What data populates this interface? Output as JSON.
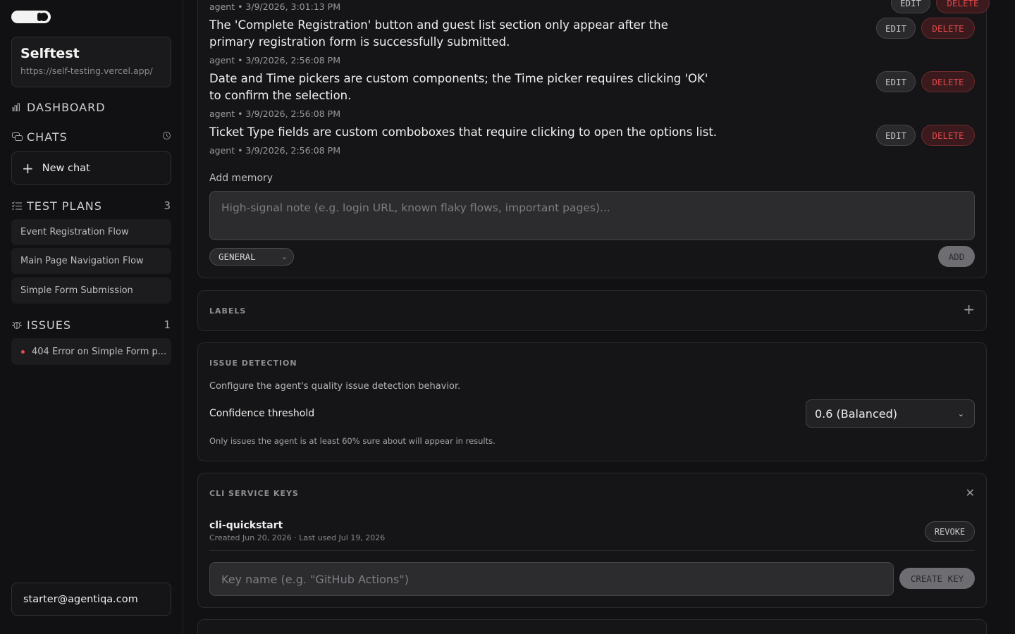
{
  "sidebar": {
    "project": {
      "name": "Selftest",
      "url": "https://self-testing.vercel.app/"
    },
    "dashboard_label": "DASHBOARD",
    "chats_label": "CHATS",
    "new_chat_label": "New chat",
    "test_plans": {
      "label": "TEST PLANS",
      "count": "3",
      "items": [
        "Event Registration Flow",
        "Main Page Navigation Flow",
        "Simple Form Submission"
      ]
    },
    "issues": {
      "label": "ISSUES",
      "count": "1",
      "items": [
        "404 Error on Simple Form p..."
      ]
    },
    "user_email": "starter@agentiqa.com"
  },
  "memories": {
    "top_meta": "agent • 3/9/2026, 3:01:13 PM",
    "items": [
      {
        "text": "The 'Complete Registration' button and guest list section only appear after the primary registration form is successfully submitted.",
        "meta": "agent • 3/9/2026, 2:56:08 PM"
      },
      {
        "text": "Date and Time pickers are custom components; the Time picker requires clicking 'OK' to confirm the selection.",
        "meta": "agent • 3/9/2026, 2:56:08 PM"
      },
      {
        "text": "Ticket Type fields are custom comboboxes that require clicking to open the options list.",
        "meta": "agent • 3/9/2026, 2:56:08 PM"
      }
    ],
    "edit_label": "EDIT",
    "delete_label": "DELETE",
    "add_memory_label": "Add memory",
    "input_placeholder": "High-signal note (e.g. login URL, known flaky flows, important pages)...",
    "category_selected": "GENERAL",
    "add_button": "ADD"
  },
  "labels_section": {
    "title": "LABELS"
  },
  "issue_detection": {
    "title": "ISSUE DETECTION",
    "description": "Configure the agent's quality issue detection behavior.",
    "confidence_label": "Confidence threshold",
    "confidence_value": "0.6 (Balanced)",
    "note": "Only issues the agent is at least 60% sure about will appear in results."
  },
  "cli_keys": {
    "title": "CLI SERVICE KEYS",
    "key_name": "cli-quickstart",
    "key_meta": "Created Jun 20, 2026 · Last used Jul 19, 2026",
    "revoke_label": "REVOKE",
    "input_placeholder": "Key name (e.g. \"GitHub Actions\")",
    "create_label": "CREATE KEY"
  }
}
